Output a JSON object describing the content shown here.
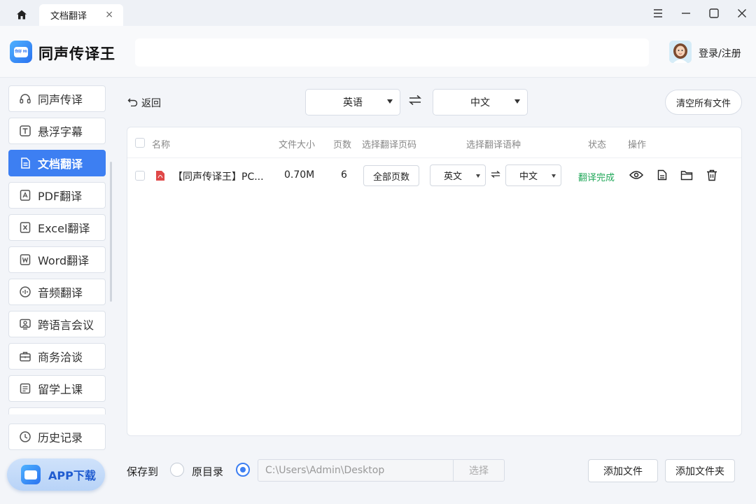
{
  "tabbar": {
    "tab_label": "文档翻译",
    "tab_close": "×"
  },
  "header": {
    "app_name": "同声传译王",
    "logo_text": "你好 Hi",
    "login_label": "登录/注册"
  },
  "sidebar": {
    "items": [
      {
        "label": "同声传译",
        "icon": "headset-icon"
      },
      {
        "label": "悬浮字幕",
        "icon": "subtitle-icon"
      },
      {
        "label": "文档翻译",
        "icon": "document-icon",
        "active": true
      },
      {
        "label": "PDF翻译",
        "icon": "pdf-icon"
      },
      {
        "label": "Excel翻译",
        "icon": "excel-icon"
      },
      {
        "label": "Word翻译",
        "icon": "word-icon"
      },
      {
        "label": "音频翻译",
        "icon": "audio-icon"
      },
      {
        "label": "跨语言会议",
        "icon": "meeting-icon"
      },
      {
        "label": "商务洽谈",
        "icon": "briefcase-icon"
      },
      {
        "label": "留学上课",
        "icon": "class-icon"
      }
    ],
    "history_label": "历史记录",
    "app_download_label": "APP下载"
  },
  "toolbar": {
    "back_label": "返回",
    "source_lang": "英语",
    "target_lang": "中文",
    "clear_label": "清空所有文件"
  },
  "table": {
    "headers": {
      "name": "名称",
      "size": "文件大小",
      "pages": "页数",
      "page_select": "选择翻译页码",
      "lang_select": "选择翻译语种",
      "status": "状态",
      "actions": "操作"
    },
    "rows": [
      {
        "name": "【同声传译王】PC...",
        "size": "0.70M",
        "pages": "6",
        "page_range": "全部页数",
        "from_lang": "英文",
        "to_lang": "中文",
        "status": "翻译完成"
      }
    ]
  },
  "bottom": {
    "save_to_label": "保存到",
    "option_original": "原目录",
    "path_value": "C:\\Users\\Admin\\Desktop",
    "choose_label": "选择",
    "add_file_label": "添加文件",
    "add_folder_label": "添加文件夹"
  },
  "colors": {
    "accent": "#3d7ff2",
    "status_done": "#22a85a",
    "pdf_red": "#e04848"
  }
}
